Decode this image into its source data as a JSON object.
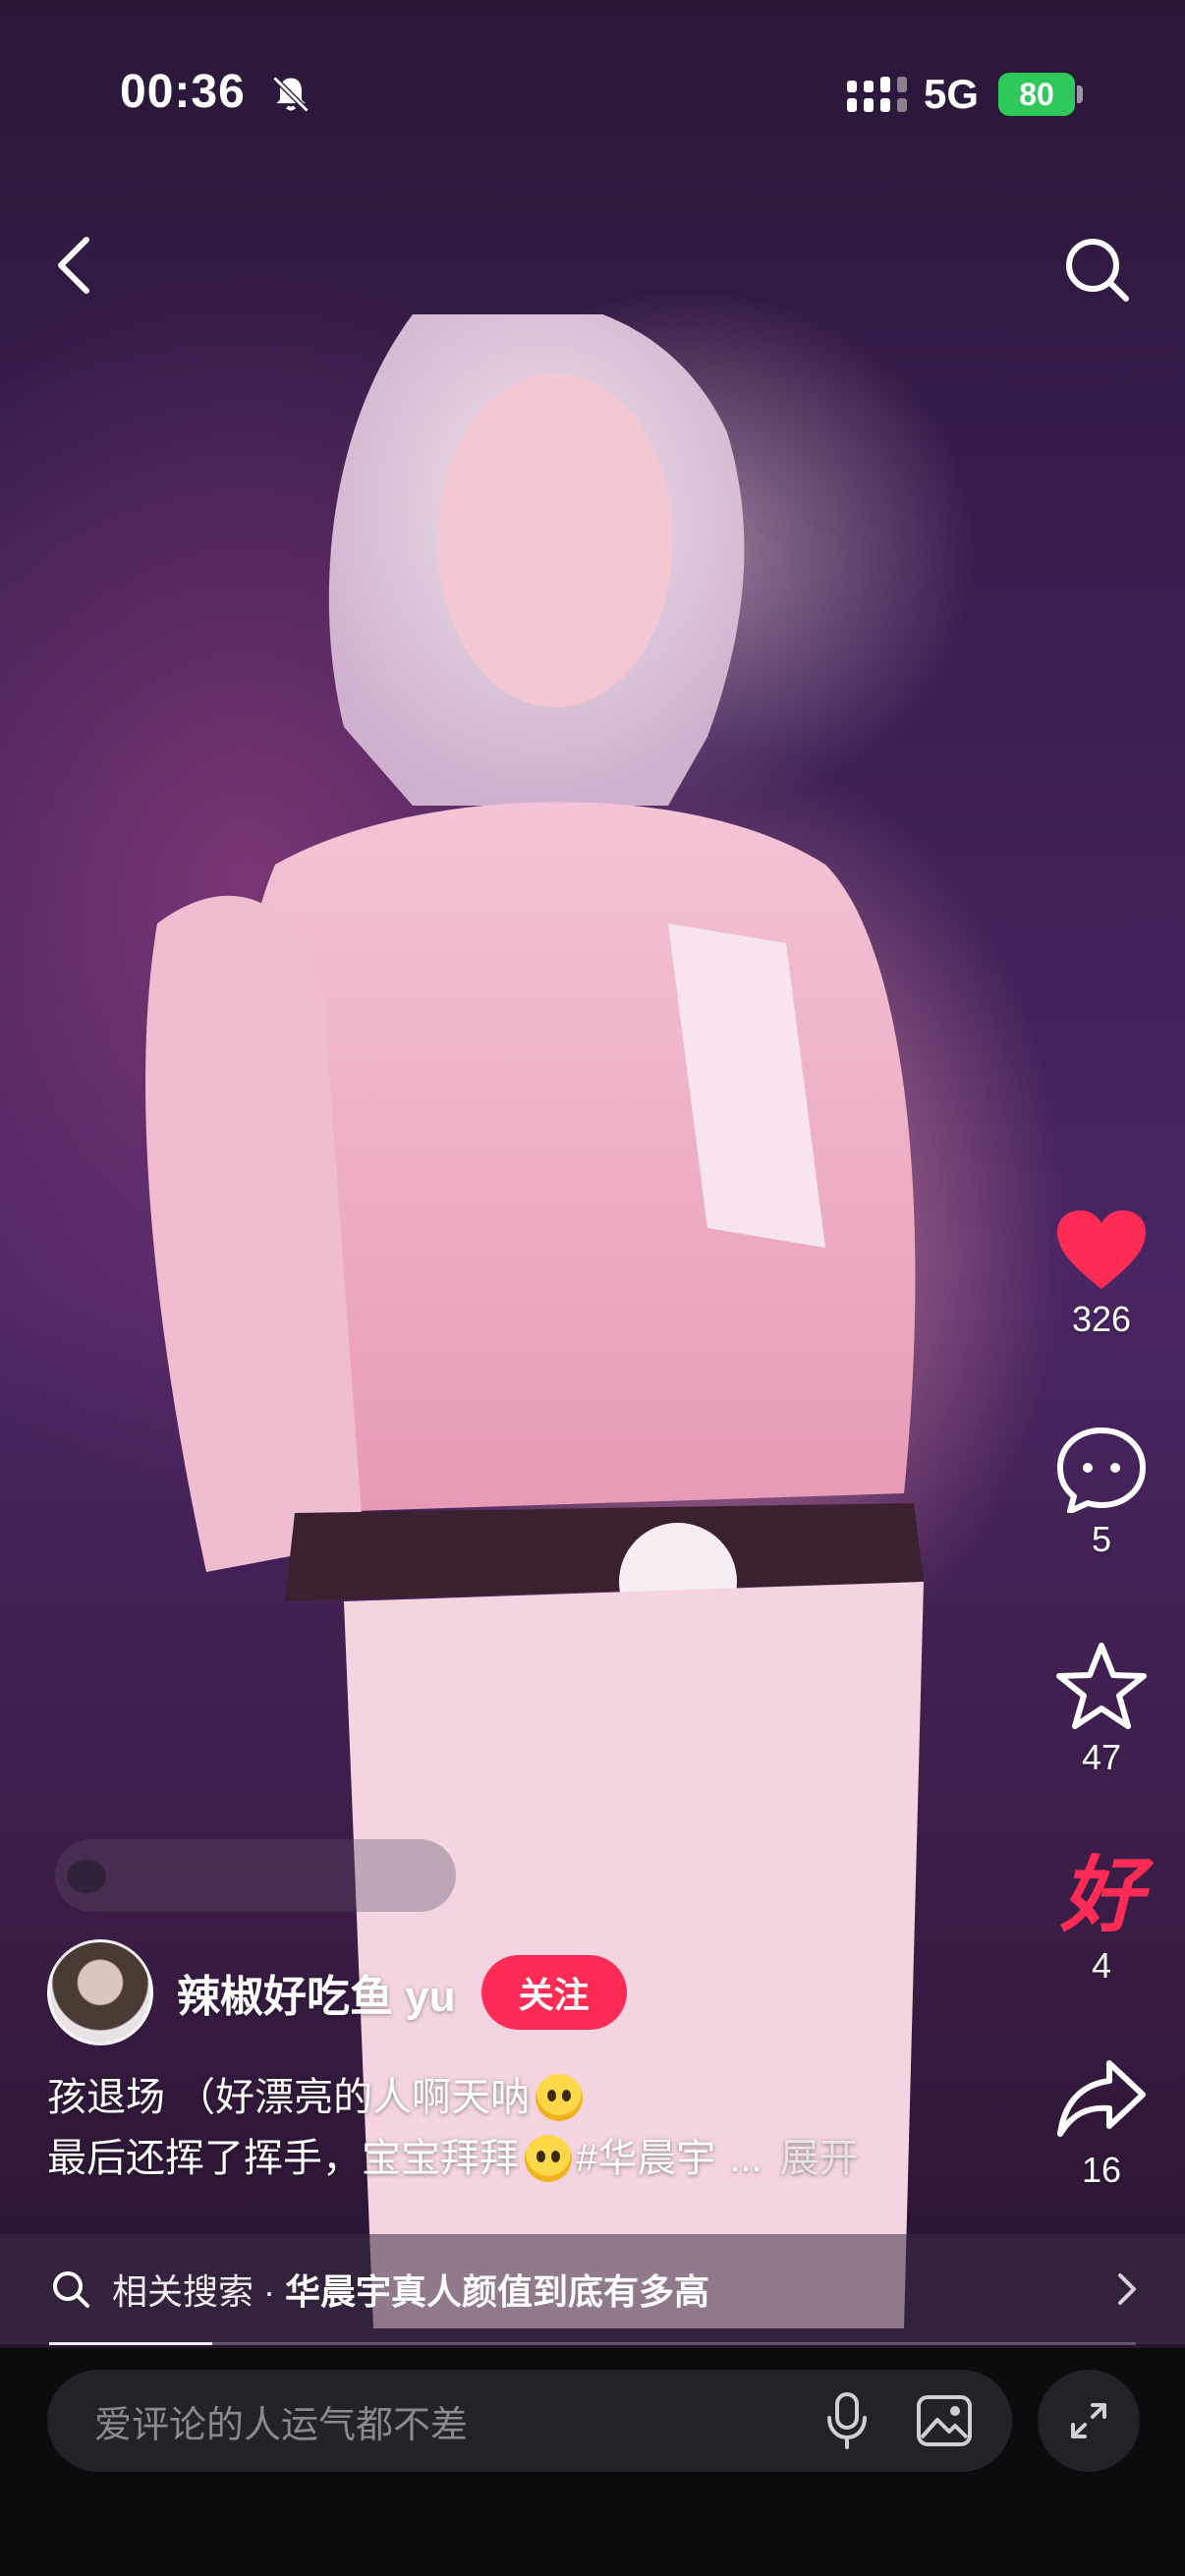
{
  "status_bar": {
    "time": "00:36",
    "network": "5G",
    "battery": "80"
  },
  "icons": {
    "back": "chevron-left-icon",
    "search": "search-icon",
    "like": "heart-icon",
    "comment": "comment-bubble-icon",
    "favorite": "star-icon",
    "recommend": "hao-badge-icon",
    "share": "share-arrow-icon"
  },
  "actions": {
    "likes": "326",
    "comments": "5",
    "favorites": "47",
    "recommends": "4",
    "shares": "16",
    "recommend_glyph": "好"
  },
  "author": {
    "name": "辣椒好吃鱼 yu",
    "follow_label": "关注"
  },
  "caption": {
    "line1": "孩退场 （好漂亮的人啊天呐",
    "line2": "最后还挥了挥手，宝宝拜拜",
    "hashtag": "#华晨宇",
    "ellipsis": "...",
    "expand_label": "展开"
  },
  "related_search": {
    "prefix": "相关搜索 · ",
    "query": "华晨宇真人颜值到底有多高"
  },
  "comment_input": {
    "placeholder": "爱评论的人运气都不差"
  },
  "colors": {
    "like_red": "#fe2c55",
    "follow_red": "#fe2c55",
    "battery_green": "#2fc85a"
  },
  "playback_progress": 0.15
}
